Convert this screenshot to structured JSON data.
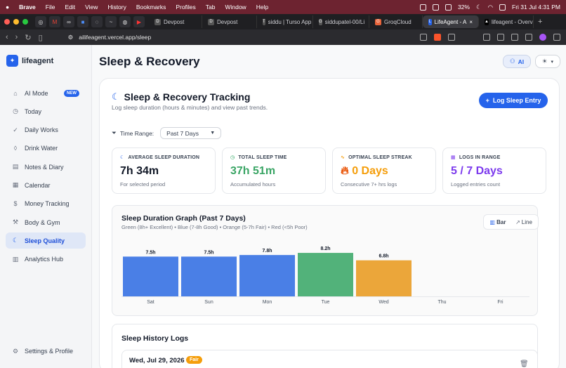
{
  "menubar": {
    "app": "Brave",
    "items": [
      "File",
      "Edit",
      "View",
      "History",
      "Bookmarks",
      "Profiles",
      "Tab",
      "Window",
      "Help"
    ],
    "battery": "32%",
    "datetime": "Fri 31 Jul  4:31 PM"
  },
  "tabs": [
    {
      "label": "Devpost",
      "fav": "D"
    },
    {
      "label": "Devpost",
      "fav": "D"
    },
    {
      "label": "siddu | Turso App",
      "fav": "T"
    },
    {
      "label": "siddupatel-00/Li",
      "fav": "G"
    },
    {
      "label": "GroqCloud",
      "fav": "G"
    },
    {
      "label": "LifeAgent - A",
      "fav": "L",
      "active": true
    },
    {
      "label": "lifeagent - Overv",
      "fav": "▲"
    }
  ],
  "address": {
    "url": "ailifeagent.vercel.app/sleep"
  },
  "brand": {
    "name": "lifeagent"
  },
  "sidebar": {
    "items": [
      {
        "label": "AI Mode",
        "icon": "ai-icon",
        "badge": "NEW"
      },
      {
        "label": "Today",
        "icon": "clock-icon"
      },
      {
        "label": "Daily Works",
        "icon": "check-circle-icon"
      },
      {
        "label": "Drink Water",
        "icon": "droplet-icon"
      },
      {
        "label": "Notes & Diary",
        "icon": "book-icon"
      },
      {
        "label": "Calendar",
        "icon": "calendar-icon"
      },
      {
        "label": "Money Tracking",
        "icon": "dollar-icon"
      },
      {
        "label": "Body & Gym",
        "icon": "dumbbell-icon"
      },
      {
        "label": "Sleep Quality",
        "icon": "moon-icon",
        "active": true
      },
      {
        "label": "Analytics Hub",
        "icon": "chart-icon"
      }
    ],
    "settings_label": "Settings & Profile"
  },
  "header": {
    "title": "Sleep & Recovery",
    "ai_label": "AI"
  },
  "panel": {
    "title": "Sleep & Recovery Tracking",
    "subtitle": "Log sleep duration (hours & minutes) and view past trends.",
    "log_button": "Log Sleep Entry",
    "range_label": "Time Range:",
    "range_value": "Past 7 Days"
  },
  "stats": [
    {
      "label": "AVERAGE SLEEP DURATION",
      "value": "7h 34m",
      "note": "For selected period",
      "color": "#111827"
    },
    {
      "label": "TOTAL SLEEP TIME",
      "value": "37h 51m",
      "note": "Accumulated hours",
      "color": "#3aa565"
    },
    {
      "label": "OPTIMAL SLEEP STREAK",
      "value": "0 Days",
      "note": "Consecutive 7+ hrs logs",
      "color": "#f59e0b"
    },
    {
      "label": "LOGS IN RANGE",
      "value": "5 / 7 Days",
      "note": "Logged entries count",
      "color": "#7c3aed"
    }
  ],
  "graph": {
    "title": "Sleep Duration Graph (Past 7 Days)",
    "legend": "Green (8h+ Excellent) • Blue (7-8h Good) • Orange (5-7h Fair) • Red (<5h Poor)",
    "toggle": [
      "Bar",
      "Line"
    ],
    "colors": {
      "good": "#4a7fe6",
      "excellent": "#52b27a",
      "fair": "#eba63a",
      "poor": "#e05252"
    }
  },
  "chart_data": {
    "type": "bar",
    "categories": [
      "Sat",
      "Sun",
      "Mon",
      "Tue",
      "Wed",
      "Thu",
      "Fri"
    ],
    "values": [
      7.5,
      7.5,
      7.8,
      8.2,
      6.8,
      null,
      null
    ],
    "value_labels": [
      "7.5h",
      "7.5h",
      "7.8h",
      "8.2h",
      "6.8h",
      "",
      ""
    ],
    "ylim": [
      0,
      9
    ],
    "title": "Sleep Duration Graph (Past 7 Days)"
  },
  "history": {
    "title": "Sleep History Logs",
    "entries": [
      {
        "date": "Wed, Jul 29, 2026",
        "tag": "Fair"
      }
    ]
  }
}
